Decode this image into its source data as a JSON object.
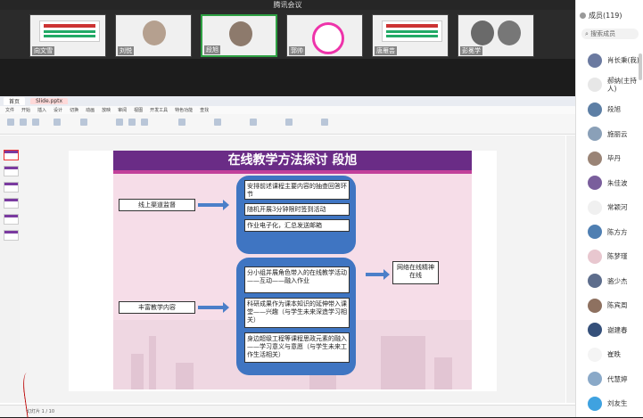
{
  "window": {
    "title": "腾讯会议"
  },
  "thumbnails": [
    {
      "name": "向文雪",
      "type": "banner"
    },
    {
      "name": "刘悦",
      "type": "face"
    },
    {
      "name": "段旭",
      "type": "face",
      "talking": true
    },
    {
      "name": "郭帅",
      "type": "logo"
    },
    {
      "name": "唐雁芸",
      "type": "banner"
    },
    {
      "name": "彭冕学",
      "type": "face"
    }
  ],
  "app": {
    "tabs": [
      "首页",
      "Slide.pptx"
    ],
    "menu": [
      "文件",
      "开始",
      "插入",
      "设计",
      "切换",
      "动画",
      "放映",
      "审阅",
      "视图",
      "开发工具",
      "特色功能",
      "查找"
    ],
    "status_text": "幻灯片 1 / 10"
  },
  "slide": {
    "title": "在线教学方法探讨     段旭",
    "left_labels": [
      "线上渠道监督",
      "丰富教学内容"
    ],
    "top_group": [
      "安排前述课程主要内容的抽查回答环节",
      "随机开展3分钟限时签到活动",
      "作业电子化，汇总发送邮箱"
    ],
    "bottom_group": [
      "分小组并展角色带入的在线教学活动——互动——融入作业",
      "科研成果作为课本知识的延伸带入课堂——兴趣（与学生未来深造学习相关）",
      "身边超级工程等课程思政元素的融入——学习意义与意愿（与学生未来工作生活相关）"
    ],
    "result": "网络在线精神在线"
  },
  "sidebar": {
    "title": "成员(119)",
    "search_placeholder": "搜索成员",
    "members": [
      {
        "name": "肖长秉(我)",
        "color": "#6b7aa0"
      },
      {
        "name": "郝纳(主持人)",
        "color": "#e7e7e7"
      },
      {
        "name": "段旭",
        "color": "#5d7fa5"
      },
      {
        "name": "施丽云",
        "color": "#8aa0b8"
      },
      {
        "name": "毕丹",
        "color": "#9a8476"
      },
      {
        "name": "朱佳波",
        "color": "#7a5e9c"
      },
      {
        "name": "常颖河",
        "color": "#f0f0f0"
      },
      {
        "name": "陈方方",
        "color": "#4f7fb2"
      },
      {
        "name": "陈梦瑾",
        "color": "#e8c7cf"
      },
      {
        "name": "骆少杰",
        "color": "#5d6d8c"
      },
      {
        "name": "陈宾周",
        "color": "#8e7160"
      },
      {
        "name": "谢建春",
        "color": "#35507a"
      },
      {
        "name": "崔昳",
        "color": "#f4f4f4"
      },
      {
        "name": "代慧婷",
        "color": "#8aa9c8"
      },
      {
        "name": "刘友生",
        "color": "#3fa2e0"
      }
    ]
  }
}
